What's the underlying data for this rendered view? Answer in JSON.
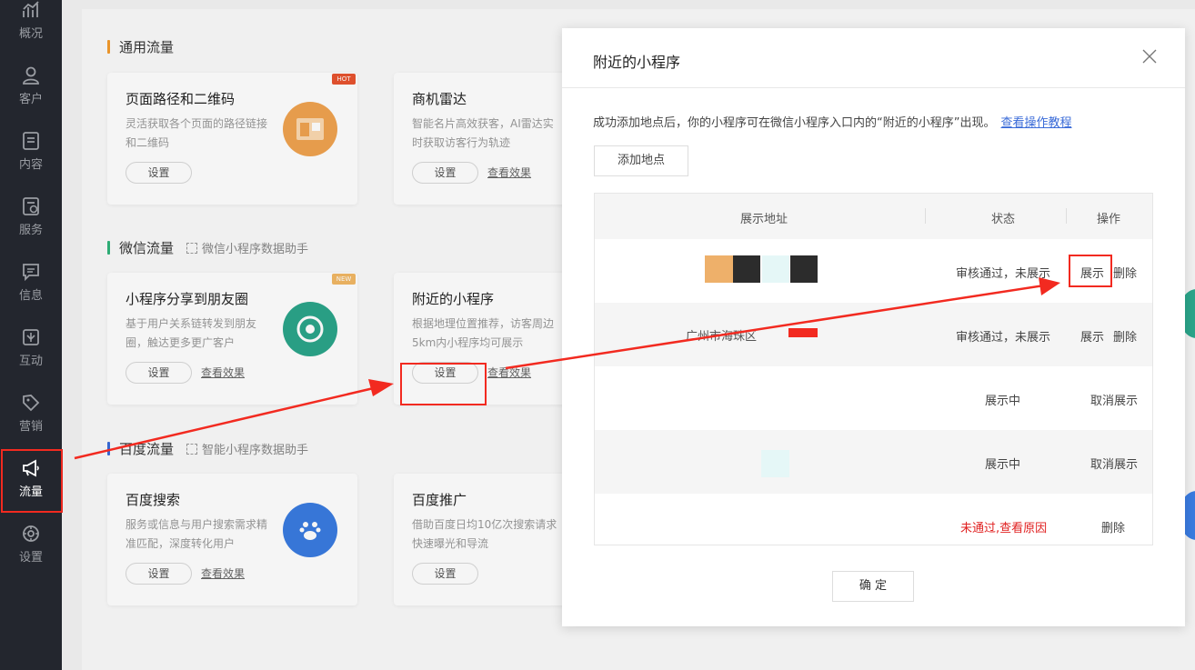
{
  "sidebar": {
    "items": [
      {
        "label": "概况",
        "icon": "chart-icon"
      },
      {
        "label": "客户",
        "icon": "user-icon"
      },
      {
        "label": "内容",
        "icon": "document-icon"
      },
      {
        "label": "服务",
        "icon": "service-icon"
      },
      {
        "label": "信息",
        "icon": "message-icon"
      },
      {
        "label": "互动",
        "icon": "interact-icon"
      },
      {
        "label": "营销",
        "icon": "tag-icon"
      },
      {
        "label": "流量",
        "icon": "megaphone-icon",
        "active": true
      },
      {
        "label": "设置",
        "icon": "gear-icon"
      }
    ]
  },
  "sections": {
    "general": {
      "title": "通用流量"
    },
    "wechat": {
      "title": "微信流量",
      "sub": "微信小程序数据助手"
    },
    "baidu": {
      "title": "百度流量",
      "sub": "智能小程序数据助手"
    }
  },
  "cards": {
    "path_qr": {
      "title": "页面路径和二维码",
      "desc": "灵活获取各个页面的路径链接和二维码",
      "btn": "设置",
      "badge": "HOT"
    },
    "radar": {
      "title": "商机雷达",
      "desc": "智能名片高效获客，AI雷达实时获取访客行为轨迹",
      "btn": "设置",
      "link": "查看效果"
    },
    "share_moments": {
      "title": "小程序分享到朋友圈",
      "desc": "基于用户关系链转发到朋友圈，触达更多更广客户",
      "btn": "设置",
      "link": "查看效果",
      "badge": "NEW"
    },
    "nearby": {
      "title": "附近的小程序",
      "desc": "根据地理位置推荐，访客周边5km内小程序均可展示",
      "btn": "设置",
      "link": "查看效果"
    },
    "baidu_search": {
      "title": "百度搜索",
      "desc": "服务或信息与用户搜索需求精准匹配，深度转化用户",
      "btn": "设置",
      "link": "查看效果"
    },
    "baidu_promo": {
      "title": "百度推广",
      "desc": "借助百度日均10亿次搜索请求快速曝光和导流",
      "btn": "设置"
    }
  },
  "modal": {
    "title": "附近的小程序",
    "notice": "成功添加地点后，你的小程序可在微信小程序入口内的“附近的小程序”出现。",
    "tutorial_link": "查看操作教程",
    "add_button": "添加地点",
    "columns": [
      "展示地址",
      "状态",
      "操作"
    ],
    "rows": [
      {
        "address": "",
        "status": "审核通过，未展示",
        "ops": [
          "展示",
          "删除"
        ]
      },
      {
        "address": "广州市海珠区",
        "status": "审核通过，未展示",
        "ops": [
          "展示",
          "删除"
        ]
      },
      {
        "address": "",
        "status": "展示中",
        "ops": [
          "取消展示"
        ]
      },
      {
        "address": "",
        "status": "展示中",
        "ops": [
          "取消展示"
        ]
      },
      {
        "address": "",
        "status": "未通过,查看原因",
        "ops": [
          "删除"
        ]
      }
    ],
    "confirm": "确 定"
  },
  "colors": {
    "sidebar_bg": "#23262e",
    "accent_orange": "#f39b2c",
    "annotation_red": "#f22a20",
    "link_blue": "#3a6bd8",
    "error_red": "#e02020"
  }
}
